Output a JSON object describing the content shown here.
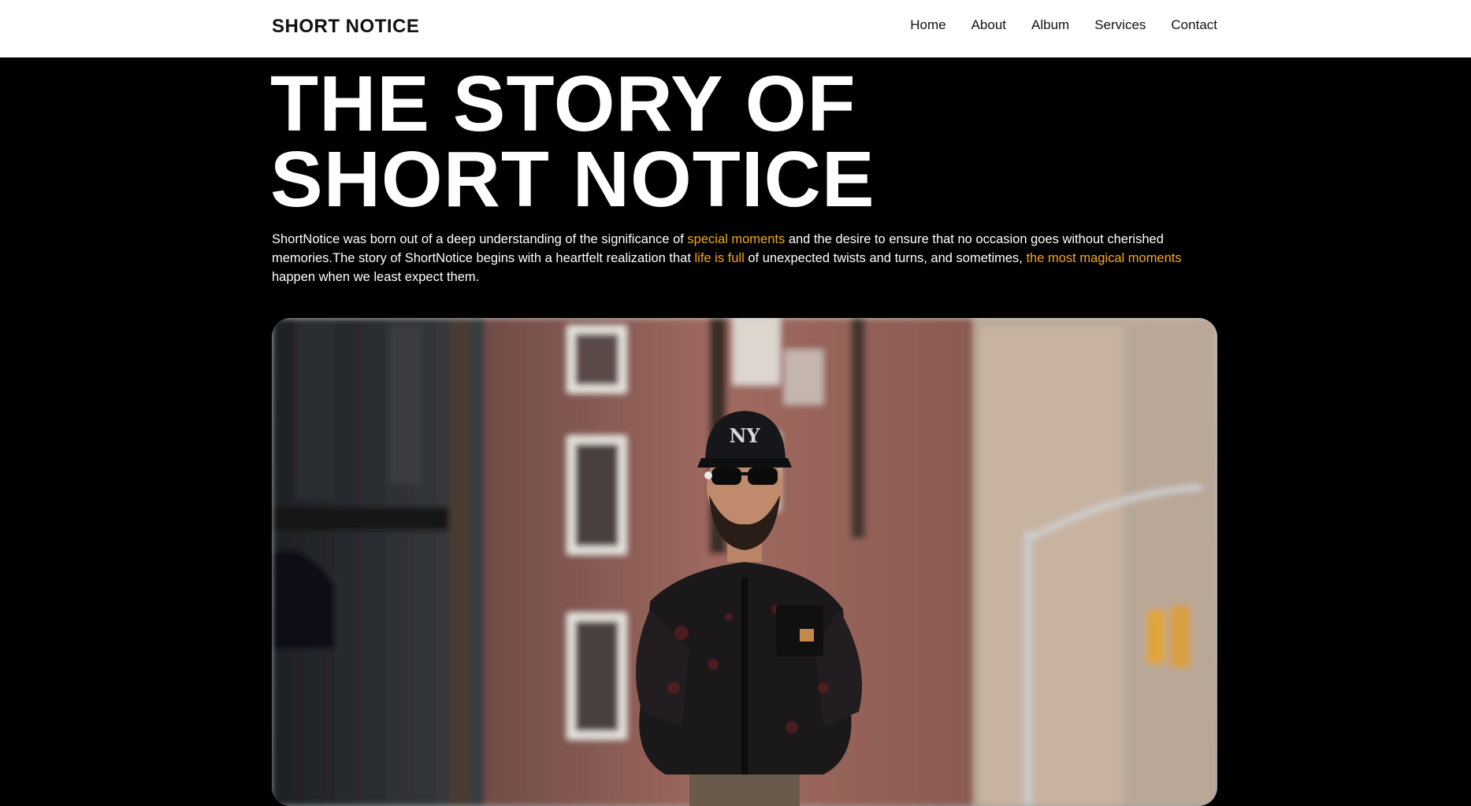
{
  "header": {
    "brand": "SHORT NOTICE",
    "nav": [
      "Home",
      "About",
      "Album",
      "Services",
      "Contact"
    ]
  },
  "hero": {
    "title_line1": "THE STORY OF",
    "title_line2": "SHORT NOTICE"
  },
  "intro": {
    "t1": "ShortNotice was born out of a deep understanding of the significance of ",
    "h1": "special moments",
    "t2": " and the desire to ensure that no occasion goes without cherished memories.The story of ShortNotice begins with a heartfelt realization that ",
    "h2": "life is full",
    "t3": " of unexpected twists and turns, and sometimes, ",
    "h3": "the most magical moments",
    "t4": " happen when we least expect them."
  },
  "colors": {
    "background": "#000000",
    "header_bg": "#ffffff",
    "highlight": "#f5a623",
    "text_light": "#ffffff"
  },
  "image": {
    "icon": "photo-image",
    "cap_logo": "NY"
  }
}
